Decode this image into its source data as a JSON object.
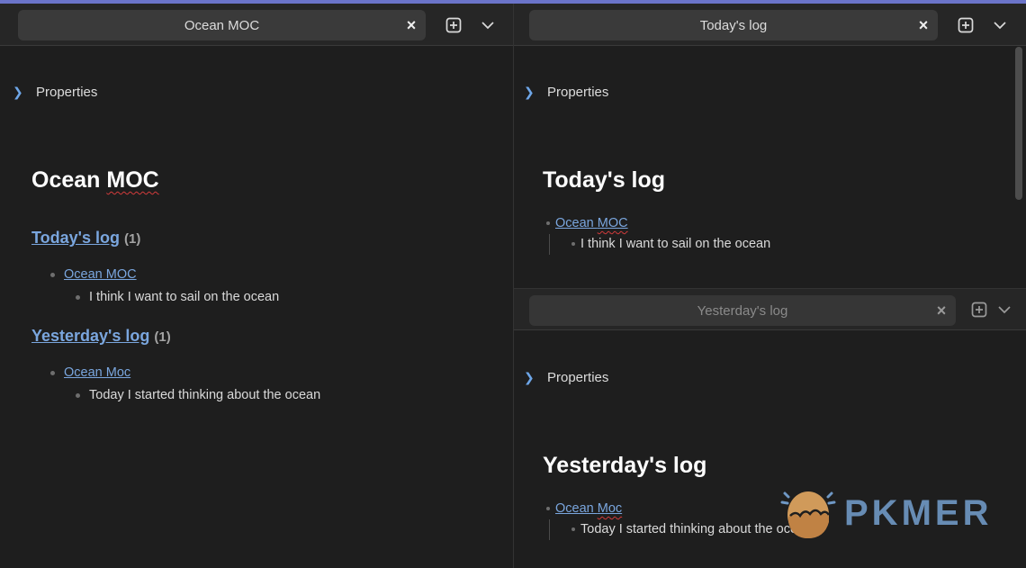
{
  "left_pane": {
    "tab_title": "Ocean MOC",
    "properties_label": "Properties",
    "title": "Ocean MOC",
    "sections": [
      {
        "heading": "Today's log",
        "count": "(1)",
        "link": "Ocean MOC",
        "text": "I think I want to sail on the ocean"
      },
      {
        "heading": "Yesterday's log",
        "count": "(1)",
        "link": "Ocean Moc",
        "text": "Today I started thinking about the ocean"
      }
    ]
  },
  "right_top_pane": {
    "tab_title": "Today's log",
    "properties_label": "Properties",
    "title": "Today's log",
    "link": "Ocean MOC",
    "text": "I think I want to sail on the ocean"
  },
  "right_bottom_pane": {
    "tab_title": "Yesterday's log",
    "properties_label": "Properties",
    "title": "Yesterday's log",
    "link": "Ocean Moc",
    "text": "Today I started thinking about the ocean"
  },
  "watermark": {
    "text": "PKMER"
  },
  "colors": {
    "accent": "#6b74c9",
    "link": "#7aa6de",
    "background": "#1e1e1e",
    "tab_bar": "#262626",
    "tab_active": "#3a3a3a"
  },
  "icons": {
    "close": "close-icon",
    "new_tab": "plus-square-icon",
    "tab_list": "chevron-down-icon",
    "collapse": "chevron-right-icon"
  }
}
